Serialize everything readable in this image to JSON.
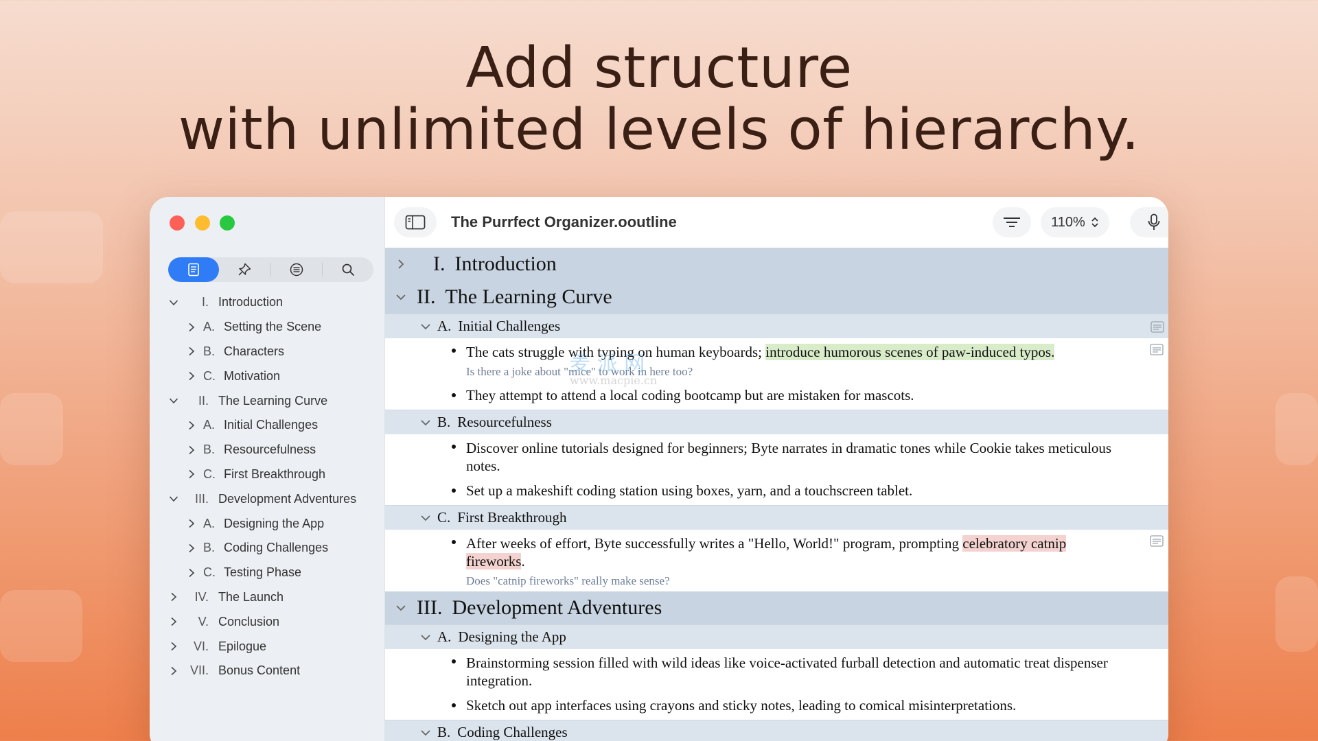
{
  "headline": {
    "line1": "Add structure",
    "line2": "with unlimited levels of hierarchy."
  },
  "window": {
    "title": "The Purrfect Organizer.ooutline",
    "zoom": "110%"
  },
  "sidebar": {
    "tabs": [
      {
        "icon": "outline-icon",
        "active": true
      },
      {
        "icon": "pin-icon",
        "active": false
      },
      {
        "icon": "filter-list-icon",
        "active": false
      },
      {
        "icon": "search-icon",
        "active": false
      }
    ],
    "items": [
      {
        "num": "I.",
        "label": "Introduction",
        "level": 0,
        "expanded": true
      },
      {
        "num": "A.",
        "label": "Setting the Scene",
        "level": 1,
        "expanded": false
      },
      {
        "num": "B.",
        "label": "Characters",
        "level": 1,
        "expanded": false
      },
      {
        "num": "C.",
        "label": "Motivation",
        "level": 1,
        "expanded": false
      },
      {
        "num": "II.",
        "label": "The Learning Curve",
        "level": 0,
        "expanded": true
      },
      {
        "num": "A.",
        "label": "Initial Challenges",
        "level": 1,
        "expanded": false
      },
      {
        "num": "B.",
        "label": "Resourcefulness",
        "level": 1,
        "expanded": false
      },
      {
        "num": "C.",
        "label": "First Breakthrough",
        "level": 1,
        "expanded": false
      },
      {
        "num": "III.",
        "label": "Development Adventures",
        "level": 0,
        "expanded": true
      },
      {
        "num": "A.",
        "label": "Designing the App",
        "level": 1,
        "expanded": false
      },
      {
        "num": "B.",
        "label": "Coding Challenges",
        "level": 1,
        "expanded": false
      },
      {
        "num": "C.",
        "label": "Testing Phase",
        "level": 1,
        "expanded": false
      },
      {
        "num": "IV.",
        "label": "The Launch",
        "level": 0,
        "expanded": false
      },
      {
        "num": "V.",
        "label": "Conclusion",
        "level": 0,
        "expanded": false
      },
      {
        "num": "VI.",
        "label": "Epilogue",
        "level": 0,
        "expanded": false
      },
      {
        "num": "VII.",
        "label": "Bonus Content",
        "level": 0,
        "expanded": false
      }
    ]
  },
  "outline": {
    "intro": {
      "num": "I.",
      "title": "Introduction"
    },
    "curve": {
      "num": "II.",
      "title": "The Learning Curve",
      "a": {
        "num": "A.",
        "title": "Initial Challenges",
        "b1_pre": "The cats struggle with typing on human keyboards; ",
        "b1_hl": "introduce humorous scenes of paw-induced typos.",
        "b1_note": "Is there a joke about \"mice\" to work in here too?",
        "b2": "They attempt to attend a local coding bootcamp but are mistaken for mascots."
      },
      "b": {
        "num": "B.",
        "title": "Resourcefulness",
        "b1": "Discover online tutorials designed for beginners; Byte narrates in dramatic tones while Cookie takes meticulous notes.",
        "b2": "Set up a makeshift coding station using boxes, yarn, and a touchscreen tablet."
      },
      "c": {
        "num": "C.",
        "title": "First Breakthrough",
        "b1_pre": "After weeks of effort, Byte successfully writes a \"Hello, World!\" program, prompting ",
        "b1_hl": "celebratory catnip fireworks",
        "b1_post": ".",
        "b1_note": "Does \"catnip fireworks\" really make sense?"
      }
    },
    "dev": {
      "num": "III.",
      "title": "Development Adventures",
      "a": {
        "num": "A.",
        "title": "Designing the App",
        "b1": "Brainstorming session filled with wild ideas like voice-activated furball detection and automatic treat dispenser integration.",
        "b2": "Sketch out app interfaces using crayons and sticky notes, leading to comical misinterpretations."
      },
      "b": {
        "num": "B.",
        "title": "Coding Challenges"
      }
    }
  },
  "watermark": {
    "main": "麦 派 网",
    "url": "www.macpie.cn"
  },
  "colors": {
    "accent": "#2f7cf6",
    "header1_bg": "#c8d4e1",
    "header2_bg": "#dbe3ec",
    "highlight_green": "#d9ecc9",
    "highlight_red": "#f3d2cf",
    "note_text": "#6e7f9a"
  }
}
